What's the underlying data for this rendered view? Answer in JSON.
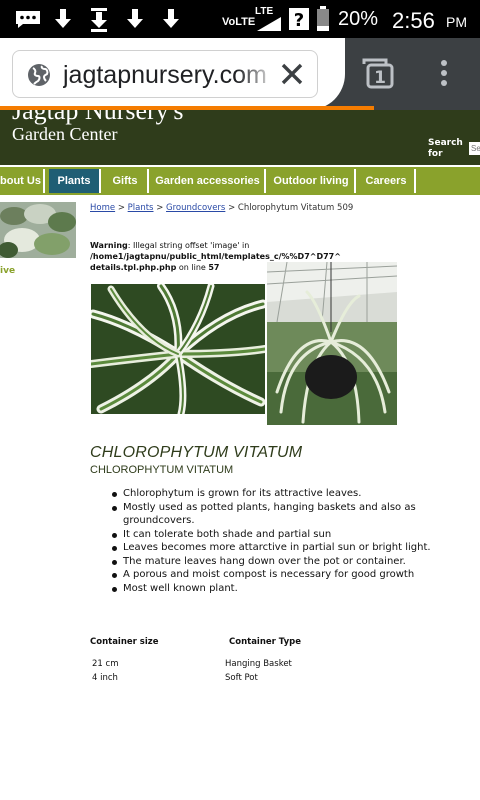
{
  "status_bar": {
    "network": "VoLTE",
    "lte": "LTE",
    "battery": "20%",
    "time": "2:56",
    "ampm": "PM"
  },
  "browser": {
    "url": "jagtapnursery.com",
    "tab_count": "1",
    "load_progress_fraction": 0.78,
    "accent_color": "#f57c00"
  },
  "site": {
    "brand": "Jagtap Nursery's",
    "tagline": "Garden Center",
    "search_label": "Search for",
    "search_placeholder": "Se",
    "nav": [
      {
        "label": "bout Us"
      },
      {
        "label": "Plants",
        "active": true
      },
      {
        "label": "Gifts"
      },
      {
        "label": "Garden accessories"
      },
      {
        "label": "Outdoor living"
      },
      {
        "label": "Careers"
      }
    ],
    "sidebar_text": "ive",
    "colors": {
      "header": "#2f3c1b",
      "nav": "#8aa22c",
      "nav_active": "#1f5e74"
    }
  },
  "breadcrumb": {
    "home": "Home",
    "plants": "Plants",
    "groundcovers": "Groundcovers",
    "sep": ">",
    "current": "Chlorophytum Vitatum 509"
  },
  "warning": {
    "label": "Warning",
    "message": ": Illegal string offset 'image' in ",
    "path": "/home1/jagtapnu/public_html/templates_c/%%D7^D77^",
    "file": "details.tpl.php.php",
    "on_line": " on line ",
    "line": "57"
  },
  "product": {
    "title": "CHLOROPHYTUM VITATUM",
    "subtitle": "CHLOROPHYTUM VITATUM",
    "bullets": [
      "Chlorophytum is grown for its attractive leaves.",
      "Mostly used as potted plants, hanging baskets and also as groundcovers.",
      "It can tolerate both shade and partial sun",
      "Leaves becomes more attarctive in partial sun or bright light.",
      "The mature leaves hang down over the pot or container.",
      "A porous and moist compost is necessary for good growth",
      "Most well known plant."
    ]
  },
  "specs": {
    "col1_header": "Container size",
    "col2_header": "Container Type",
    "rows": [
      {
        "size": "21 cm",
        "type": "Hanging Basket"
      },
      {
        "size": "4 inch",
        "type": "Soft Pot"
      }
    ]
  }
}
